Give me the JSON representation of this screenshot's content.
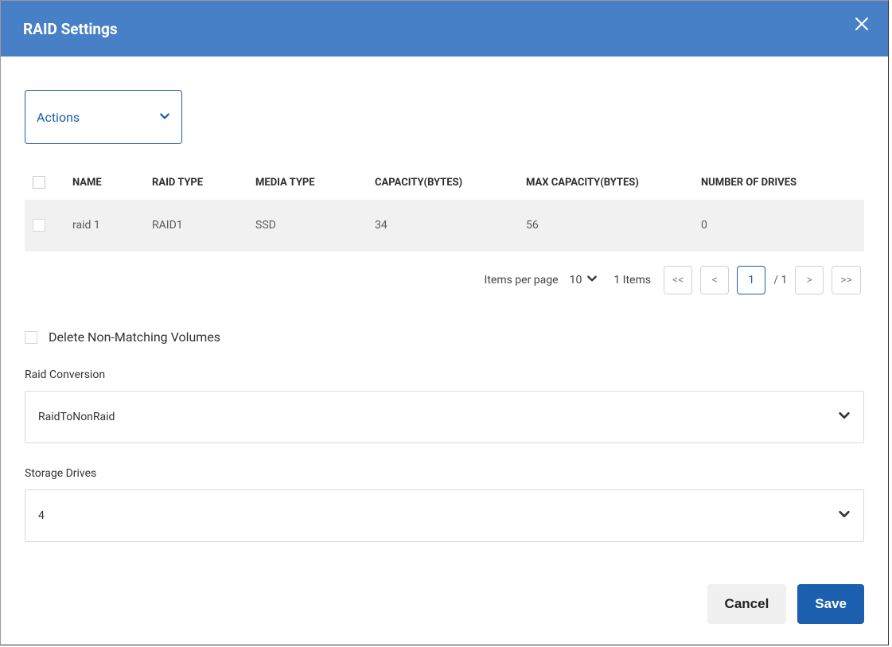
{
  "header": {
    "title": "RAID Settings"
  },
  "actions": {
    "label": "Actions"
  },
  "table": {
    "headers": {
      "name": "NAME",
      "raid_type": "RAID TYPE",
      "media_type": "MEDIA TYPE",
      "capacity": "CAPACITY(BYTES)",
      "max_capacity": "MAX CAPACITY(BYTES)",
      "num_drives": "NUMBER OF DRIVES"
    },
    "rows": [
      {
        "name": "raid 1",
        "raid_type": "RAID1",
        "media_type": "SSD",
        "capacity": "34",
        "max_capacity": "56",
        "num_drives": "0"
      }
    ]
  },
  "pager": {
    "items_per_page_label": "Items per page",
    "items_per_page_value": "10",
    "items_count_label": "1 Items",
    "first": "<<",
    "prev": "<",
    "current": "1",
    "total_suffix": "/ 1",
    "next": ">",
    "last": ">>"
  },
  "delete_non_matching": {
    "label": "Delete Non-Matching Volumes",
    "checked": false
  },
  "raid_conversion": {
    "label": "Raid Conversion",
    "value": "RaidToNonRaid"
  },
  "storage_drives": {
    "label": "Storage Drives",
    "value": "4"
  },
  "footer": {
    "cancel": "Cancel",
    "save": "Save"
  }
}
